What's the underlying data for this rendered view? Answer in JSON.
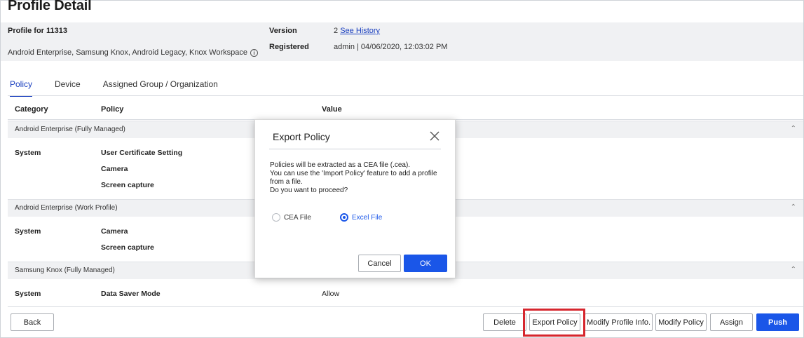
{
  "page": {
    "title": "Profile Detail"
  },
  "info": {
    "profile_for": "Profile for 11313",
    "platforms": "Android Enterprise, Samsung Knox, Android Legacy, Knox Workspace",
    "version_label": "Version",
    "version_value": "2",
    "see_history": "See History",
    "registered_label": "Registered",
    "registered_value": "admin | 04/06/2020, 12:03:02 PM",
    "info_icon": "i"
  },
  "tabs": [
    {
      "label": "Policy",
      "active": true
    },
    {
      "label": "Device",
      "active": false
    },
    {
      "label": "Assigned Group / Organization",
      "active": false
    }
  ],
  "table": {
    "headers": {
      "category": "Category",
      "policy": "Policy",
      "value": "Value"
    },
    "sections": [
      {
        "name": "Android Enterprise (Fully Managed)",
        "rows": [
          {
            "category": "System",
            "policy": "User Certificate Setting",
            "value": ""
          },
          {
            "category": "",
            "policy": "Camera",
            "value": ""
          },
          {
            "category": "",
            "policy": "Screen capture",
            "value": ""
          }
        ]
      },
      {
        "name": "Android Enterprise (Work Profile)",
        "rows": [
          {
            "category": "System",
            "policy": "Camera",
            "value": ""
          },
          {
            "category": "",
            "policy": "Screen capture",
            "value": ""
          }
        ]
      },
      {
        "name": "Samsung Knox (Fully Managed)",
        "rows": [
          {
            "category": "System",
            "policy": "Data Saver Mode",
            "value": "Allow"
          }
        ]
      }
    ]
  },
  "modal": {
    "title": "Export Policy",
    "message_lines": [
      "Policies will be extracted as a CEA file (.cea).",
      "You can use the 'Import Policy' feature to add a profile",
      "from a file.",
      "Do you want to proceed?"
    ],
    "options": [
      {
        "label": "CEA File",
        "selected": false
      },
      {
        "label": "Excel File",
        "selected": true
      }
    ],
    "cancel": "Cancel",
    "ok": "OK"
  },
  "footer": {
    "back": "Back",
    "delete": "Delete",
    "export_policy": "Export Policy",
    "modify_profile_info": "Modify Profile Info.",
    "modify_policy": "Modify Policy",
    "assign": "Assign",
    "push": "Push"
  },
  "colors": {
    "accent": "#1a56e8",
    "link": "#1a3fbf",
    "highlight": "#d6262e",
    "band": "#f0f1f3"
  }
}
